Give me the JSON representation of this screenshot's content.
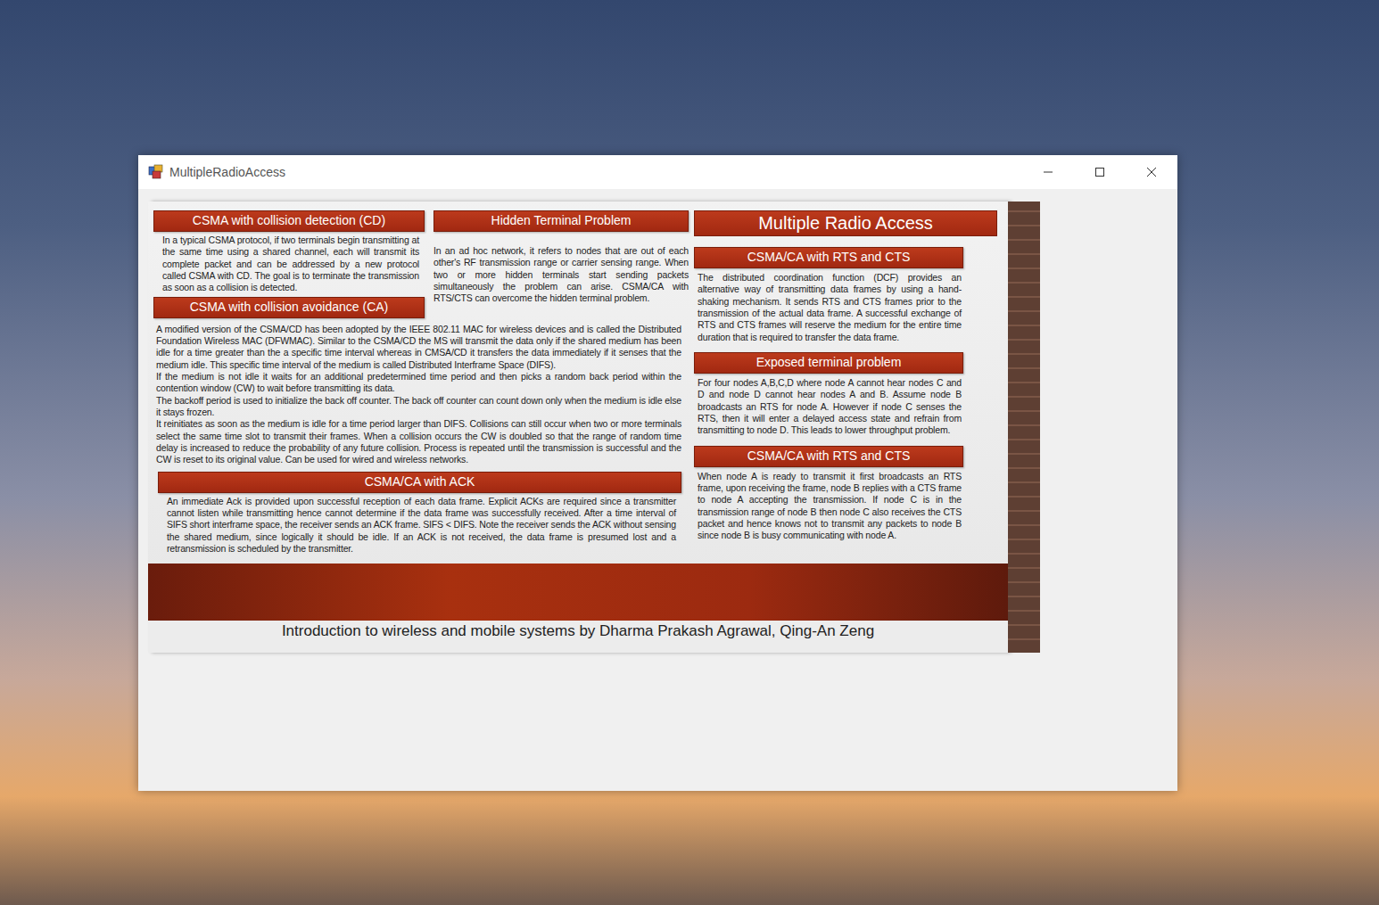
{
  "window": {
    "title": "MultipleRadioAccess"
  },
  "poster": {
    "title": "Multiple Radio Access",
    "left_column": [
      {
        "heading": "CSMA with collision detection (CD)",
        "paragraphs": [
          "In a typical CSMA protocol, if two terminals begin transmitting at the same time using a shared channel, each will transmit its complete packet and can be addressed by a new protocol called CSMA with CD. The goal is to terminate the transmission as soon as a collision is detected."
        ]
      },
      {
        "heading": "CSMA with collision avoidance (CA)",
        "paragraphs": []
      }
    ],
    "middle_column": [
      {
        "heading": "Hidden Terminal Problem",
        "paragraphs": [
          "In an ad hoc network, it refers to nodes that are out of each other's RF transmission range or carrier sensing range. When two or more hidden terminals start sending packets simultaneously the problem can arise. CSMA/CA with RTS/CTS can overcome the hidden terminal problem."
        ]
      }
    ],
    "wide_text": [
      "A modified version of the CSMA/CD has been adopted by the IEEE 802.11 MAC for wireless devices and is called the Distributed Foundation Wireless MAC (DFWMAC). Similar to the CSMA/CD the MS will transmit the data only if the shared medium has been idle for a time greater than the a specific time interval whereas in CMSA/CD it transfers the data immediately if it senses that the medium idle. This specific time interval of the medium is called Distributed Interframe Space (DIFS).",
      "If the medium is not idle it waits for an additional predetermined time period and then picks a random back period within the contention window (CW) to wait before transmitting its data.",
      "The backoff period is used to initialize the back off counter. The back off counter can count down only when the medium is idle else it stays frozen.",
      "It reinitiates as soon as the medium is idle for a time period larger than DIFS. Collisions can still occur when two or more terminals select the same time slot to transmit their frames. When a collision occurs the CW is doubled so that the range of random time delay is increased to reduce the probability of any future collision. Process is repeated until the transmission is successful and the CW is reset to its original value. Can be used for wired and wireless networks."
    ],
    "lower_left": [
      {
        "heading": "CSMA/CA with ACK",
        "paragraphs": [
          "An immediate Ack is provided upon successful reception of each data frame. Explicit ACKs are required since a transmitter cannot listen while transmitting hence cannot determine if the data frame was successfully received. After a time interval of SIFS short interframe space, the receiver sends an ACK frame. SIFS < DIFS. Note the receiver sends the ACK without sensing the shared medium, since logically it should be idle. If an ACK is not received, the data frame is presumed lost and a retransmission is scheduled by the transmitter."
        ]
      }
    ],
    "right_column": [
      {
        "heading": "CSMA/CA with RTS and CTS",
        "paragraphs": [
          "The distributed coordination function (DCF) provides an alternative way of transmitting data frames by using a hand-shaking mechanism. It sends RTS and CTS frames prior to the transmission of the actual data frame. A successful exchange of RTS and CTS frames will reserve the medium for the entire time duration that is required to transfer the data frame."
        ]
      },
      {
        "heading": "Exposed terminal problem",
        "paragraphs": [
          "For four nodes A,B,C,D where node A cannot hear nodes C and D and node D cannot hear nodes A and B. Assume node B broadcasts an RTS for node A. However if node C senses the RTS, then it will enter a delayed access state and refrain from transmitting to node D. This leads to lower throughput problem."
        ]
      },
      {
        "heading": "CSMA/CA with RTS and CTS",
        "paragraphs": [
          "When node A is ready to transmit it first broadcasts an RTS frame, upon receiving the frame, node B replies with a CTS frame to node A accepting the transmission. If node C is in the transmission range of node B then node C also receives the CTS packet and hence knows not to transmit any packets to node B since node B is busy communicating with node A."
        ]
      }
    ],
    "caption": "Introduction to wireless and mobile systems by Dharma Prakash Agrawal, Qing-An Zeng"
  }
}
